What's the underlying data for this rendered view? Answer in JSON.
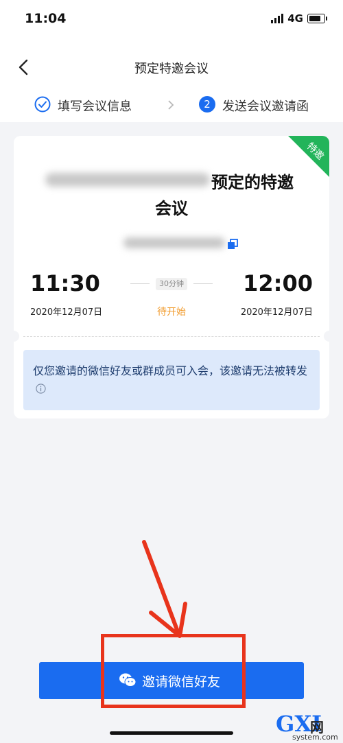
{
  "status_bar": {
    "time": "11:04",
    "network": "4G"
  },
  "nav": {
    "title": "预定特邀会议"
  },
  "steps": {
    "step1_label": "填写会议信息",
    "step2_number": "2",
    "step2_label": "发送会议邀请函"
  },
  "card": {
    "ribbon": "特邀",
    "title_line1": "预定的特邀",
    "title_line2": "会议",
    "start_time": "11:30",
    "end_time": "12:00",
    "duration": "30分钟",
    "start_date": "2020年12月07日",
    "end_date": "2020年12月07日",
    "status": "待开始",
    "notice": "仅您邀请的微信好友或群成员可入会，该邀请无法被转发"
  },
  "invite_button": {
    "label": "邀请微信好友"
  },
  "watermark": {
    "brand": "GXI",
    "cn": "网",
    "domain": "system.com"
  },
  "colors": {
    "primary": "#1a6cf0",
    "status_orange": "#f19b2c",
    "annotation_red": "#e8341c",
    "notice_bg": "#dde9fb"
  }
}
